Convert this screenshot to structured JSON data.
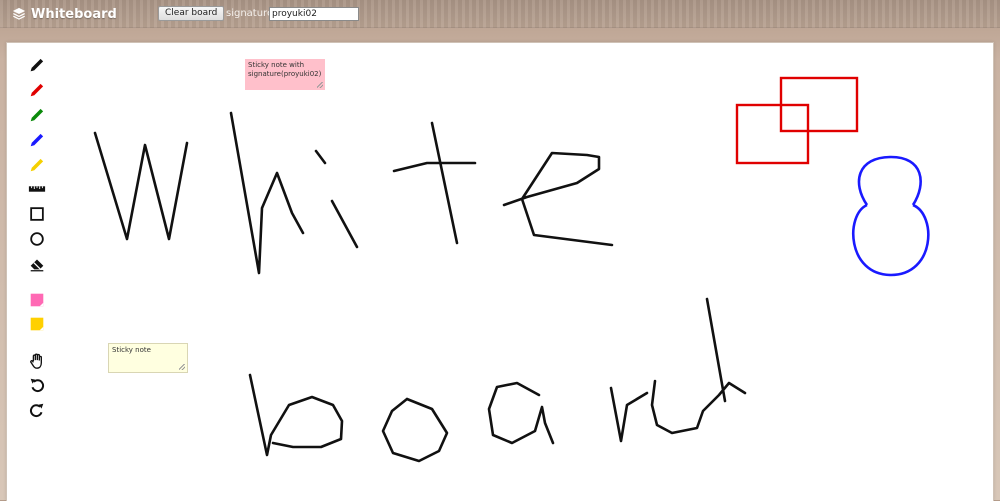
{
  "app": {
    "title": "Whiteboard",
    "logo_icon": "layers-icon"
  },
  "toolbar": {
    "clear_label": "Clear board",
    "signature_label": "signature",
    "signature_value": "proyuki02"
  },
  "tools": [
    {
      "name": "pen-black",
      "icon": "pencil-icon",
      "color": "#111111"
    },
    {
      "name": "pen-red",
      "icon": "pencil-icon",
      "color": "#e00000"
    },
    {
      "name": "pen-green",
      "icon": "pencil-icon",
      "color": "#0a8a0a"
    },
    {
      "name": "pen-blue",
      "icon": "pencil-icon",
      "color": "#1a1aff"
    },
    {
      "name": "pen-yellow",
      "icon": "pencil-icon",
      "color": "#f5d000"
    },
    {
      "name": "ruler",
      "icon": "ruler-icon",
      "color": "#111111"
    },
    {
      "name": "rectangle",
      "icon": "square-icon",
      "color": "#111111"
    },
    {
      "name": "circle",
      "icon": "circle-icon",
      "color": "#111111"
    },
    {
      "name": "eraser",
      "icon": "eraser-icon",
      "color": "#111111"
    },
    {
      "name": "sticky-pink",
      "icon": "sticky-note-icon",
      "color": "#ff69b4"
    },
    {
      "name": "sticky-yellow",
      "icon": "sticky-note-icon",
      "color": "#ffd000"
    },
    {
      "name": "hand",
      "icon": "hand-icon",
      "color": "#111111"
    },
    {
      "name": "undo",
      "icon": "undo-icon",
      "color": "#111111"
    },
    {
      "name": "redo",
      "icon": "redo-icon",
      "color": "#111111"
    }
  ],
  "notes": {
    "pink": {
      "text": "Sticky note with signature(proyuki02)",
      "color": "#ffc0cb"
    },
    "yellow": {
      "text": "Sticky note",
      "color": "#ffffe0"
    }
  },
  "drawing_colors": {
    "ink": "#111111",
    "rect": "#e00000",
    "eight": "#1a1aff"
  }
}
